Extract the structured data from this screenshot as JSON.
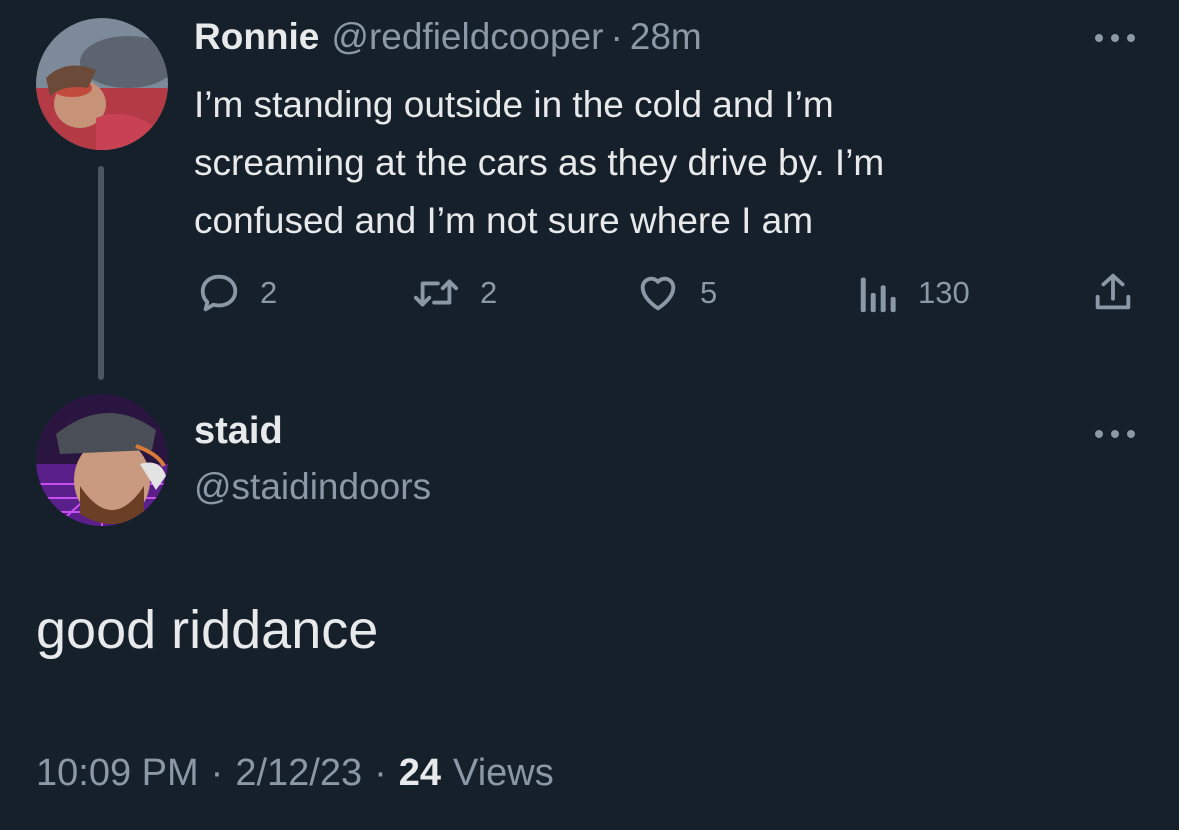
{
  "parent_tweet": {
    "author_name": "Ronnie",
    "handle": "@redfieldcooper",
    "separator": "·",
    "time_ago": "28m",
    "text": "I’m standing outside in the cold and I’m\nscreaming at the cars as they drive by. I’m\nconfused and I’m not sure where I am",
    "replies": "2",
    "retweets": "2",
    "likes": "5",
    "views": "130",
    "icons": {
      "reply": "speech-bubble-icon",
      "retweet": "retweet-arrows-icon",
      "like": "heart-icon",
      "views": "bar-chart-icon",
      "share": "upload-share-icon",
      "more": "more-dots-icon"
    }
  },
  "reply_tweet": {
    "author_name": "staid",
    "handle": "@staidindoors",
    "text": "good riddance",
    "time": "10:09 PM",
    "separator": "·",
    "date": "2/12/23",
    "views_count": "24",
    "views_label": "Views"
  },
  "colors": {
    "background": "#15202b",
    "primary_text": "#e7e9ea",
    "secondary_text": "#8b98a5",
    "thread_line": "#4a5662"
  }
}
